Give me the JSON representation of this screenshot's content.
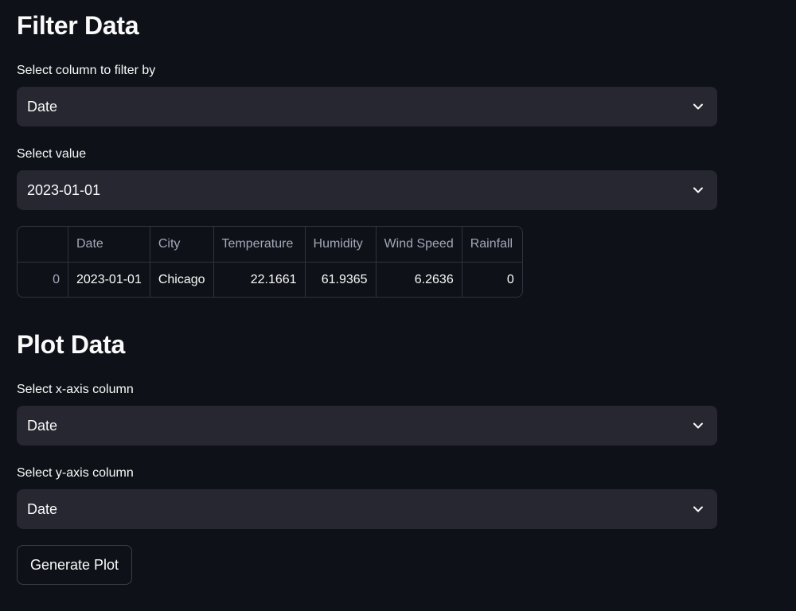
{
  "filter_section": {
    "title": "Filter Data",
    "column_select": {
      "label": "Select column to filter by",
      "value": "Date",
      "icon": "chevron-down-icon"
    },
    "value_select": {
      "label": "Select value",
      "value": "2023-01-01",
      "icon": "chevron-down-icon"
    }
  },
  "table": {
    "headers": [
      "",
      "Date",
      "City",
      "Temperature",
      "Humidity",
      "Wind Speed",
      "Rainfall"
    ],
    "rows": [
      [
        "0",
        "2023-01-01",
        "Chicago",
        "22.1661",
        "61.9365",
        "6.2636",
        "0"
      ]
    ]
  },
  "plot_section": {
    "title": "Plot Data",
    "x_select": {
      "label": "Select x-axis column",
      "value": "Date",
      "icon": "chevron-down-icon"
    },
    "y_select": {
      "label": "Select y-axis column",
      "value": "Date",
      "icon": "chevron-down-icon"
    },
    "button_label": "Generate Plot"
  },
  "colors": {
    "background": "#0e1117",
    "input_bg": "#262730",
    "border": "#31333f",
    "text": "#fafafa",
    "muted_text": "#a3a8b8"
  }
}
